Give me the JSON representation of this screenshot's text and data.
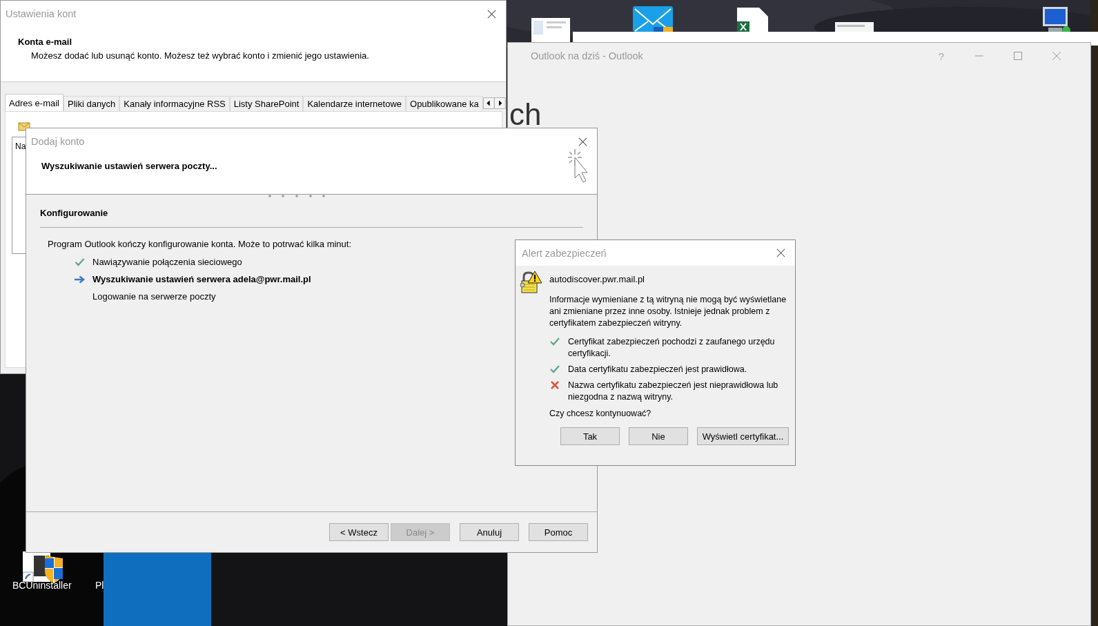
{
  "desktop": {
    "icons": [
      {
        "label": "BCUninstaller"
      },
      {
        "label": "Pl"
      }
    ]
  },
  "account_settings": {
    "title": "Ustawienia kont",
    "heading": "Konta e-mail",
    "description": "Możesz dodać lub usunąć konto. Możesz też wybrać konto i zmienić jego ustawienia.",
    "tabs": [
      {
        "label": "Adres e-mail",
        "selected": true
      },
      {
        "label": "Pliki danych",
        "selected": false
      },
      {
        "label": "Kanały informacyjne RSS",
        "selected": false
      },
      {
        "label": "Listy SharePoint",
        "selected": false
      },
      {
        "label": "Kalendarze internetowe",
        "selected": false
      },
      {
        "label": "Opublikowane ka",
        "selected": false
      }
    ],
    "list_text": "Na"
  },
  "outlook": {
    "title": "Outlook na dziś  -  Outlook",
    "help": "?",
    "content_text": "ch"
  },
  "add_account": {
    "title": "Dodaj konto",
    "heading": "Wyszukiwanie ustawień serwera poczty...",
    "section": "Konfigurowanie",
    "intro": "Program Outlook kończy konfigurowanie konta. Może to potrwać kilka minut:",
    "steps": [
      {
        "kind": "done",
        "text": "Nawiązywanie połączenia sieciowego"
      },
      {
        "kind": "current",
        "text": "Wyszukiwanie ustawień serwera adela@pwr.mail.pl"
      },
      {
        "kind": "pending",
        "text": "Logowanie na serwerze poczty"
      }
    ],
    "buttons": [
      {
        "label": "< Wstecz",
        "disabled": false
      },
      {
        "label": "Dalej >",
        "disabled": true
      },
      {
        "label": "Anuluj",
        "disabled": false
      },
      {
        "label": "Pomoc",
        "disabled": false
      }
    ]
  },
  "security_alert": {
    "title": "Alert zabezpieczeń",
    "host": "autodiscover.pwr.mail.pl",
    "message": "Informacje wymieniane z tą witryną nie mogą być wyświetlane ani zmieniane przez inne osoby. Istnieje jednak problem z certyfikatem zabezpieczeń witryny.",
    "checks": [
      {
        "ok": true,
        "text": "Certyfikat zabezpieczeń pochodzi z zaufanego urzędu certyfikacji."
      },
      {
        "ok": true,
        "text": "Data certyfikatu zabezpieczeń jest prawidłowa."
      },
      {
        "ok": false,
        "text": "Nazwa certyfikatu zabezpieczeń jest nieprawidłowa lub niezgodna z nazwą witryny."
      }
    ],
    "question": "Czy chcesz kontynuować?",
    "buttons": [
      {
        "label": "Tak"
      },
      {
        "label": "Nie"
      },
      {
        "label": "Wyświetl certyfikat..."
      }
    ]
  }
}
